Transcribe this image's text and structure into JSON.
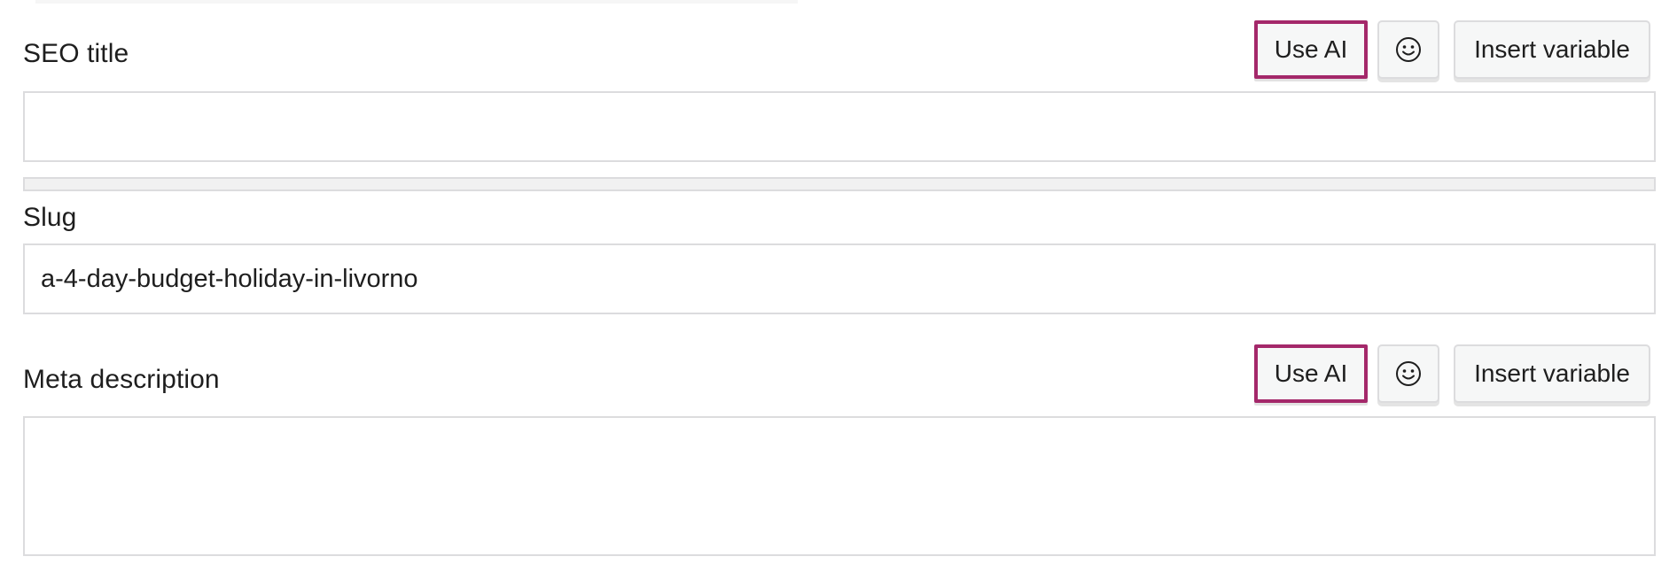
{
  "seo_title": {
    "label": "SEO title",
    "value": "",
    "buttons": {
      "use_ai": "Use AI",
      "emoji_icon": "smiley-face-icon",
      "insert_variable": "Insert variable"
    },
    "length_progress": 0
  },
  "slug": {
    "label": "Slug",
    "value": "a-4-day-budget-holiday-in-livorno"
  },
  "meta_description": {
    "label": "Meta description",
    "value": "",
    "buttons": {
      "use_ai": "Use AI",
      "emoji_icon": "smiley-face-icon",
      "insert_variable": "Insert variable"
    }
  },
  "colors": {
    "ai_button_border": "#a4286a",
    "field_border": "#dcdcde",
    "button_background": "#f6f7f7"
  }
}
